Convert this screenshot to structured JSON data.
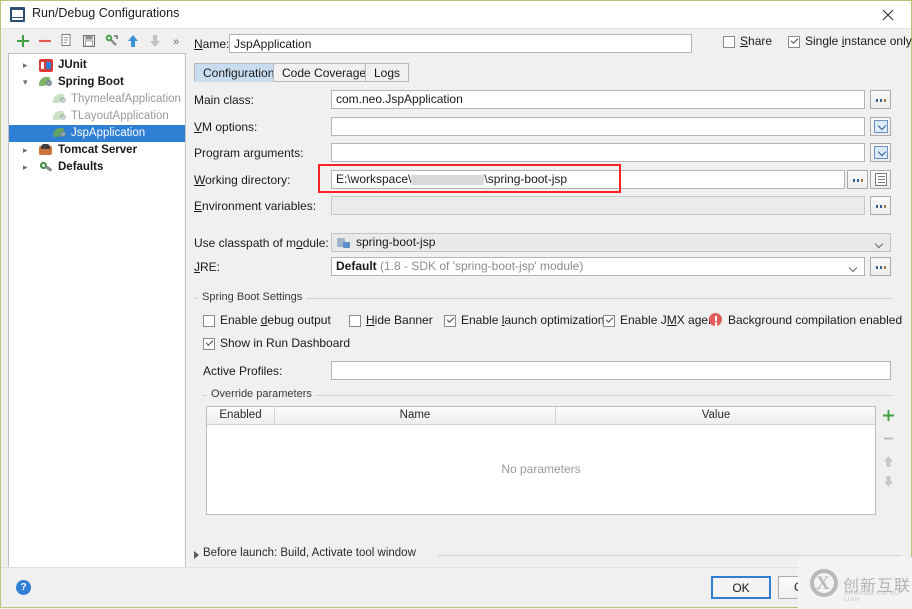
{
  "window": {
    "title": "Run/Debug Configurations",
    "icon": "intellij-idea-icon",
    "close_label": "✕"
  },
  "toolbar": {
    "items": [
      {
        "name": "add-configuration-button",
        "glyph": "+"
      },
      {
        "name": "remove-configuration-button",
        "glyph": "−"
      },
      {
        "name": "copy-configuration-button",
        "glyph": "copy-icon"
      },
      {
        "name": "save-configuration-button",
        "glyph": "save-icon"
      },
      {
        "name": "edit-templates-button",
        "glyph": "wrench-icon"
      },
      {
        "name": "move-up-button",
        "glyph": "arrow-up-icon"
      },
      {
        "name": "move-down-button",
        "glyph": "arrow-down-icon"
      },
      {
        "name": "more-options-button",
        "glyph": "»"
      }
    ]
  },
  "tree": {
    "nodes": [
      {
        "label": "JUnit",
        "type": "root",
        "icon": "junit-icon",
        "expanded": false,
        "selected": false
      },
      {
        "label": "Spring Boot",
        "type": "root",
        "icon": "spring-boot-icon",
        "expanded": true,
        "selected": false
      },
      {
        "label": "ThymeleafApplication",
        "type": "child",
        "icon": "spring-boot-icon",
        "selected": false
      },
      {
        "label": "TLayoutApplication",
        "type": "child",
        "icon": "spring-boot-icon",
        "selected": false
      },
      {
        "label": "JspApplication",
        "type": "child",
        "icon": "spring-boot-icon",
        "selected": true
      },
      {
        "label": "Tomcat Server",
        "type": "root",
        "icon": "tomcat-icon",
        "expanded": false,
        "selected": false
      },
      {
        "label": "Defaults",
        "type": "root",
        "icon": "defaults-icon",
        "expanded": false,
        "selected": false
      }
    ]
  },
  "header": {
    "name_label": "Name:",
    "name_value": "JspApplication",
    "share_label": "Share",
    "share_checked": false,
    "single_instance_label": "Single instance only",
    "single_instance_checked": true
  },
  "tabs": [
    {
      "label": "Configuration",
      "active": true
    },
    {
      "label": "Code Coverage",
      "active": false
    },
    {
      "label": "Logs",
      "active": false
    }
  ],
  "form": {
    "main_class": {
      "label": "Main class:",
      "value": "com.neo.JspApplication"
    },
    "vm_options": {
      "label": "VM options:",
      "value": ""
    },
    "program_arguments": {
      "label": "Program arguments:",
      "value": ""
    },
    "working_directory": {
      "label": "Working directory:",
      "value_prefix": "E:\\workspace\\",
      "value_suffix": "\\spring-boot-jsp",
      "highlighted": true
    },
    "environment_variables": {
      "label": "Environment variables:",
      "value": ""
    },
    "use_classpath_of_module": {
      "label": "Use classpath of module:",
      "value": "spring-boot-jsp"
    },
    "jre": {
      "label": "JRE:",
      "value_bold": "Default",
      "value_rest": "(1.8 - SDK of 'spring-boot-jsp' module)"
    }
  },
  "spring_boot_settings": {
    "group_title": "Spring Boot Settings",
    "checkboxes": [
      {
        "label": "Enable debug output",
        "checked": false
      },
      {
        "label": "Hide Banner",
        "checked": false
      },
      {
        "label": "Enable launch optimization",
        "checked": true
      },
      {
        "label": "Enable JMX agent",
        "checked": true
      },
      {
        "label": "Show in Run Dashboard",
        "checked": true
      }
    ],
    "warning_text": "Background compilation enabled",
    "warning_color": "#e05c5c",
    "active_profiles_label": "Active Profiles:",
    "active_profiles_value": ""
  },
  "override_parameters": {
    "group_title": "Override parameters",
    "columns": [
      "Enabled",
      "Name",
      "Value"
    ],
    "rows": [],
    "empty_text": "No parameters",
    "side_buttons": [
      {
        "name": "add-parameter-button",
        "glyph": "+"
      },
      {
        "name": "remove-parameter-button",
        "glyph": "−"
      },
      {
        "name": "move-parameter-up-button",
        "glyph": "↑"
      },
      {
        "name": "move-parameter-down-button",
        "glyph": "↓"
      }
    ]
  },
  "before_launch": {
    "text": "Before launch: Build, Activate tool window",
    "expanded": false
  },
  "footer": {
    "help_label": "?",
    "ok_label": "OK",
    "cancel_label": "Canc"
  },
  "watermark": {
    "chinese": "创新互联",
    "pinyin": "CHUANG XIN HU LIAN",
    "mark": "X"
  },
  "colors": {
    "selection": "#2f7fd4",
    "highlight_box": "#fb2323",
    "tab_active": "#c9ddf0"
  }
}
